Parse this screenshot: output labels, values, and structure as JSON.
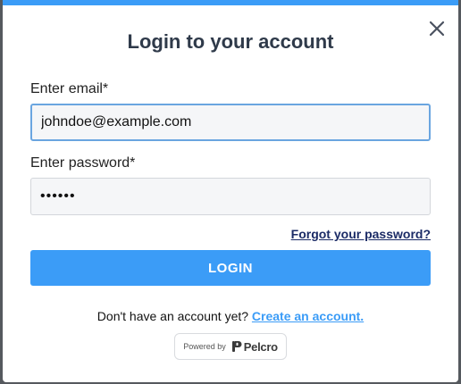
{
  "modal": {
    "title": "Login to your account",
    "close_icon": "close-icon"
  },
  "form": {
    "email_label": "Enter email*",
    "email_value": "johndoe@example.com",
    "password_label": "Enter password*",
    "password_value": "••••••",
    "forgot_link": "Forgot your password?",
    "login_button": "LOGIN"
  },
  "signup": {
    "prompt": "Don't have an account yet?",
    "link": "Create an account."
  },
  "branding": {
    "powered_by": "Powered by",
    "brand_name": "Pelcro",
    "logo_icon": "pelcro-logo-icon"
  },
  "colors": {
    "accent": "#3b9cf7",
    "title": "#2f3a4a",
    "forgot_link": "#1b2b66"
  }
}
